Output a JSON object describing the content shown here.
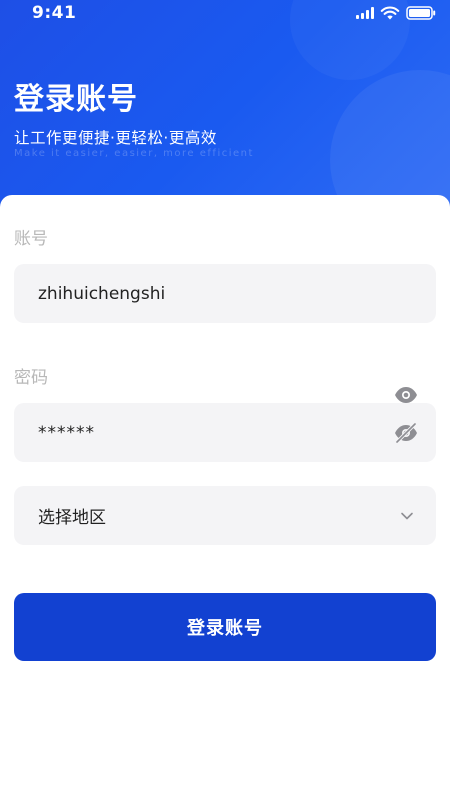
{
  "status_bar": {
    "time": "9:41",
    "icons": [
      "signal-icon",
      "wifi-icon",
      "battery-icon"
    ]
  },
  "header": {
    "title": "登录账号",
    "subtitle": "让工作更便捷·更轻松·更高效",
    "subtitle_en": "Make it easier, easier, more efficient"
  },
  "form": {
    "account": {
      "label": "账号",
      "value": "zhihuichengshi"
    },
    "password": {
      "label": "密码",
      "value": "******",
      "icons": [
        "eye-icon",
        "eye-off-icon"
      ]
    },
    "region": {
      "value": "选择地区",
      "icon": "chevron-down-icon"
    },
    "submit_label": "登录账号"
  },
  "colors": {
    "header_gradient_start": "#1e4fe6",
    "header_gradient_end": "#2f6cf5",
    "button": "#1241d1",
    "input_bg": "#f4f4f6",
    "label_gray": "#b8b8b8"
  }
}
